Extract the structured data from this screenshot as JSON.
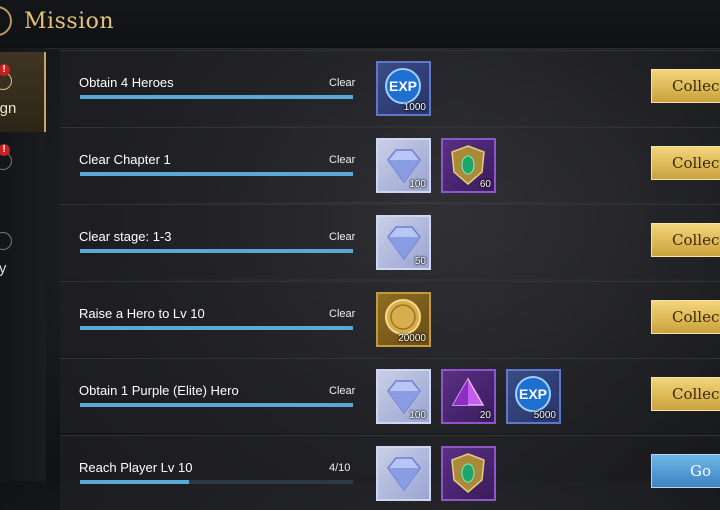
{
  "header": {
    "title": "Mission"
  },
  "sidebar": {
    "tabs": [
      {
        "label": "aign",
        "alert": "!",
        "active": true
      },
      {
        "label": "y",
        "alert": "!",
        "active": false
      },
      {
        "label": "kly",
        "alert": "",
        "active": false
      }
    ]
  },
  "missions": [
    {
      "name": "Obtain 4 Heroes",
      "status": "Clear",
      "progress": 1.0,
      "button": "Collect",
      "rewards": [
        {
          "icon": "exp-icon",
          "qty": "1000"
        }
      ]
    },
    {
      "name": "Clear Chapter 1",
      "status": "Clear",
      "progress": 1.0,
      "button": "Collect",
      "rewards": [
        {
          "icon": "diamond-icon",
          "qty": "100"
        },
        {
          "icon": "shield-emblem-icon",
          "qty": "60"
        }
      ]
    },
    {
      "name": "Clear stage: 1-3",
      "status": "Clear",
      "progress": 1.0,
      "button": "Collect",
      "rewards": [
        {
          "icon": "diamond-icon",
          "qty": "50"
        }
      ]
    },
    {
      "name": "Raise a Hero to Lv 10",
      "status": "Clear",
      "progress": 1.0,
      "button": "Collect",
      "rewards": [
        {
          "icon": "gold-coin-icon",
          "qty": "20000"
        }
      ]
    },
    {
      "name": "Obtain 1 Purple (Elite) Hero",
      "status": "Clear",
      "progress": 1.0,
      "button": "Collect",
      "rewards": [
        {
          "icon": "diamond-icon",
          "qty": "100"
        },
        {
          "icon": "purple-crystal-icon",
          "qty": "20"
        },
        {
          "icon": "exp-icon",
          "qty": "5000"
        }
      ]
    },
    {
      "name": "Reach Player Lv 10",
      "status": "4/10",
      "progress": 0.4,
      "button": "Go",
      "rewards": [
        {
          "icon": "diamond-icon",
          "qty": ""
        },
        {
          "icon": "shield-emblem-icon",
          "qty": ""
        }
      ]
    }
  ],
  "colors": {
    "accent_gold": "#e2c27a",
    "progress": "#5aa8d6",
    "collect": "#f3d57a",
    "go": "#6fb7e8"
  }
}
